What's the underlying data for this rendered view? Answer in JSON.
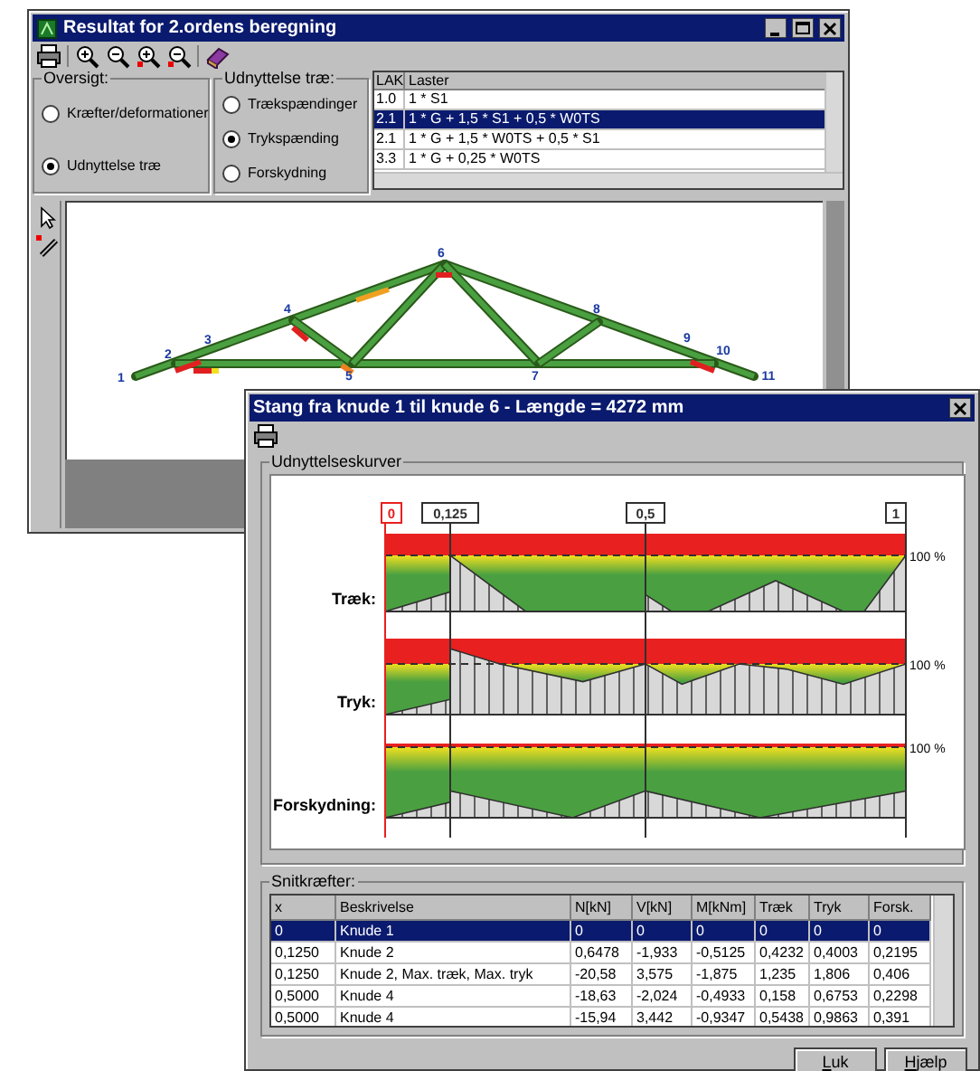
{
  "window": {
    "title": "Resultat for 2.ordens beregning"
  },
  "overview": {
    "legend": "Oversigt:",
    "options": [
      {
        "label": "Kræfter/deformationer",
        "selected": false
      },
      {
        "label": "Udnyttelse træ",
        "selected": true
      }
    ]
  },
  "utilization": {
    "legend": "Udnyttelse træ:",
    "options": [
      {
        "label": "Trækspændinger",
        "selected": false
      },
      {
        "label": "Trykspænding",
        "selected": true
      },
      {
        "label": "Forskydning",
        "selected": false
      }
    ]
  },
  "load_list": {
    "columns": [
      "LAK",
      "Laster"
    ],
    "rows": [
      {
        "lak": "1.0",
        "loads": "1 * S1",
        "selected": false
      },
      {
        "lak": "2.1",
        "loads": "1 * G + 1,5 * S1 + 0,5 * W0TS",
        "selected": true
      },
      {
        "lak": "2.1",
        "loads": "1 * G + 1,5 * W0TS + 0,5 * S1",
        "selected": false
      },
      {
        "lak": "3.3",
        "loads": "1 * G + 0,25 * W0TS",
        "selected": false
      }
    ]
  },
  "truss": {
    "nodes": [
      "1",
      "2",
      "3",
      "4",
      "5",
      "6",
      "7",
      "8",
      "9",
      "10",
      "11"
    ]
  },
  "detail_window": {
    "title": "Stang fra knude 1 til knude 6 - Længde = 4272 mm",
    "curves": {
      "legend": "Udnyttelseskurver",
      "positions": [
        {
          "label": "0",
          "selected": true
        },
        {
          "label": "0,125",
          "selected": false
        },
        {
          "label": "0,5",
          "selected": false
        },
        {
          "label": "1",
          "selected": false
        }
      ],
      "rows": [
        {
          "label": "Træk:",
          "limit": "100 %"
        },
        {
          "label": "Tryk:",
          "limit": "100 %"
        },
        {
          "label": "Forskydning:",
          "limit": "100 %"
        }
      ]
    },
    "forces": {
      "legend": "Snitkræfter:",
      "columns": [
        "x",
        "Beskrivelse",
        "N[kN]",
        "V[kN]",
        "M[kNm]",
        "Træk",
        "Tryk",
        "Forsk."
      ],
      "rows": [
        {
          "cells": [
            "0",
            "Knude 1",
            "0",
            "0",
            "0",
            "0",
            "0",
            "0"
          ],
          "selected": true
        },
        {
          "cells": [
            "0,1250",
            "Knude 2",
            "0,6478",
            "-1,933",
            "-0,5125",
            "0,4232",
            "0,4003",
            "0,2195"
          ],
          "selected": false
        },
        {
          "cells": [
            "0,1250",
            "Knude 2, Max. træk, Max. tryk",
            "-20,58",
            "3,575",
            "-1,875",
            "1,235",
            "1,806",
            "0,406"
          ],
          "selected": false
        },
        {
          "cells": [
            "0,5000",
            "Knude 4",
            "-18,63",
            "-2,024",
            "-0,4933",
            "0,158",
            "0,6753",
            "0,2298"
          ],
          "selected": false
        },
        {
          "cells": [
            "0,5000",
            "Knude 4",
            "-15,94",
            "3,442",
            "-0,9347",
            "0,5438",
            "0,9863",
            "0,391"
          ],
          "selected": false
        }
      ]
    },
    "buttons": [
      "Luk",
      "Hjælp"
    ]
  }
}
